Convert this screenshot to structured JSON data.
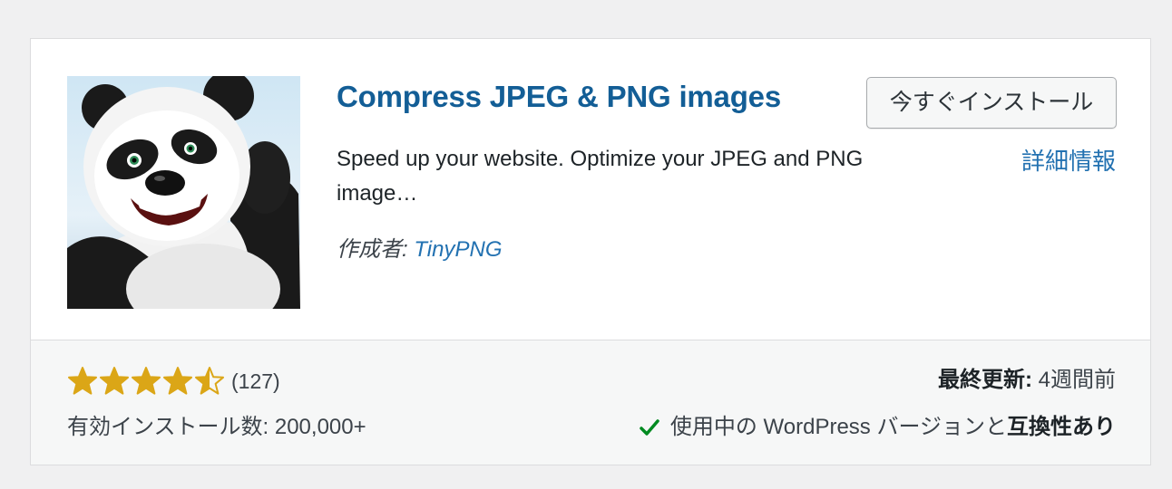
{
  "plugin": {
    "title": "Compress JPEG & PNG images",
    "description": "Speed up your website. Optimize your JPEG and PNG image…",
    "author_label": "作成者: ",
    "author_name": "TinyPNG",
    "install_label": "今すぐインストール",
    "details_label": "詳細情報",
    "icon": "panda-mascot-icon"
  },
  "footer": {
    "rating": 4.5,
    "rating_max": 5,
    "rating_count": "(127)",
    "installs_label": "有効インストール数: 200,000+",
    "last_updated_label": "最終更新:",
    "last_updated_value": " 4週間前",
    "compat_prefix": "使用中の WordPress バージョンと",
    "compat_strong": "互換性あり"
  },
  "colors": {
    "title": "#135e96",
    "link": "#2271b1",
    "star": "#dba617",
    "check": "#008a20"
  }
}
